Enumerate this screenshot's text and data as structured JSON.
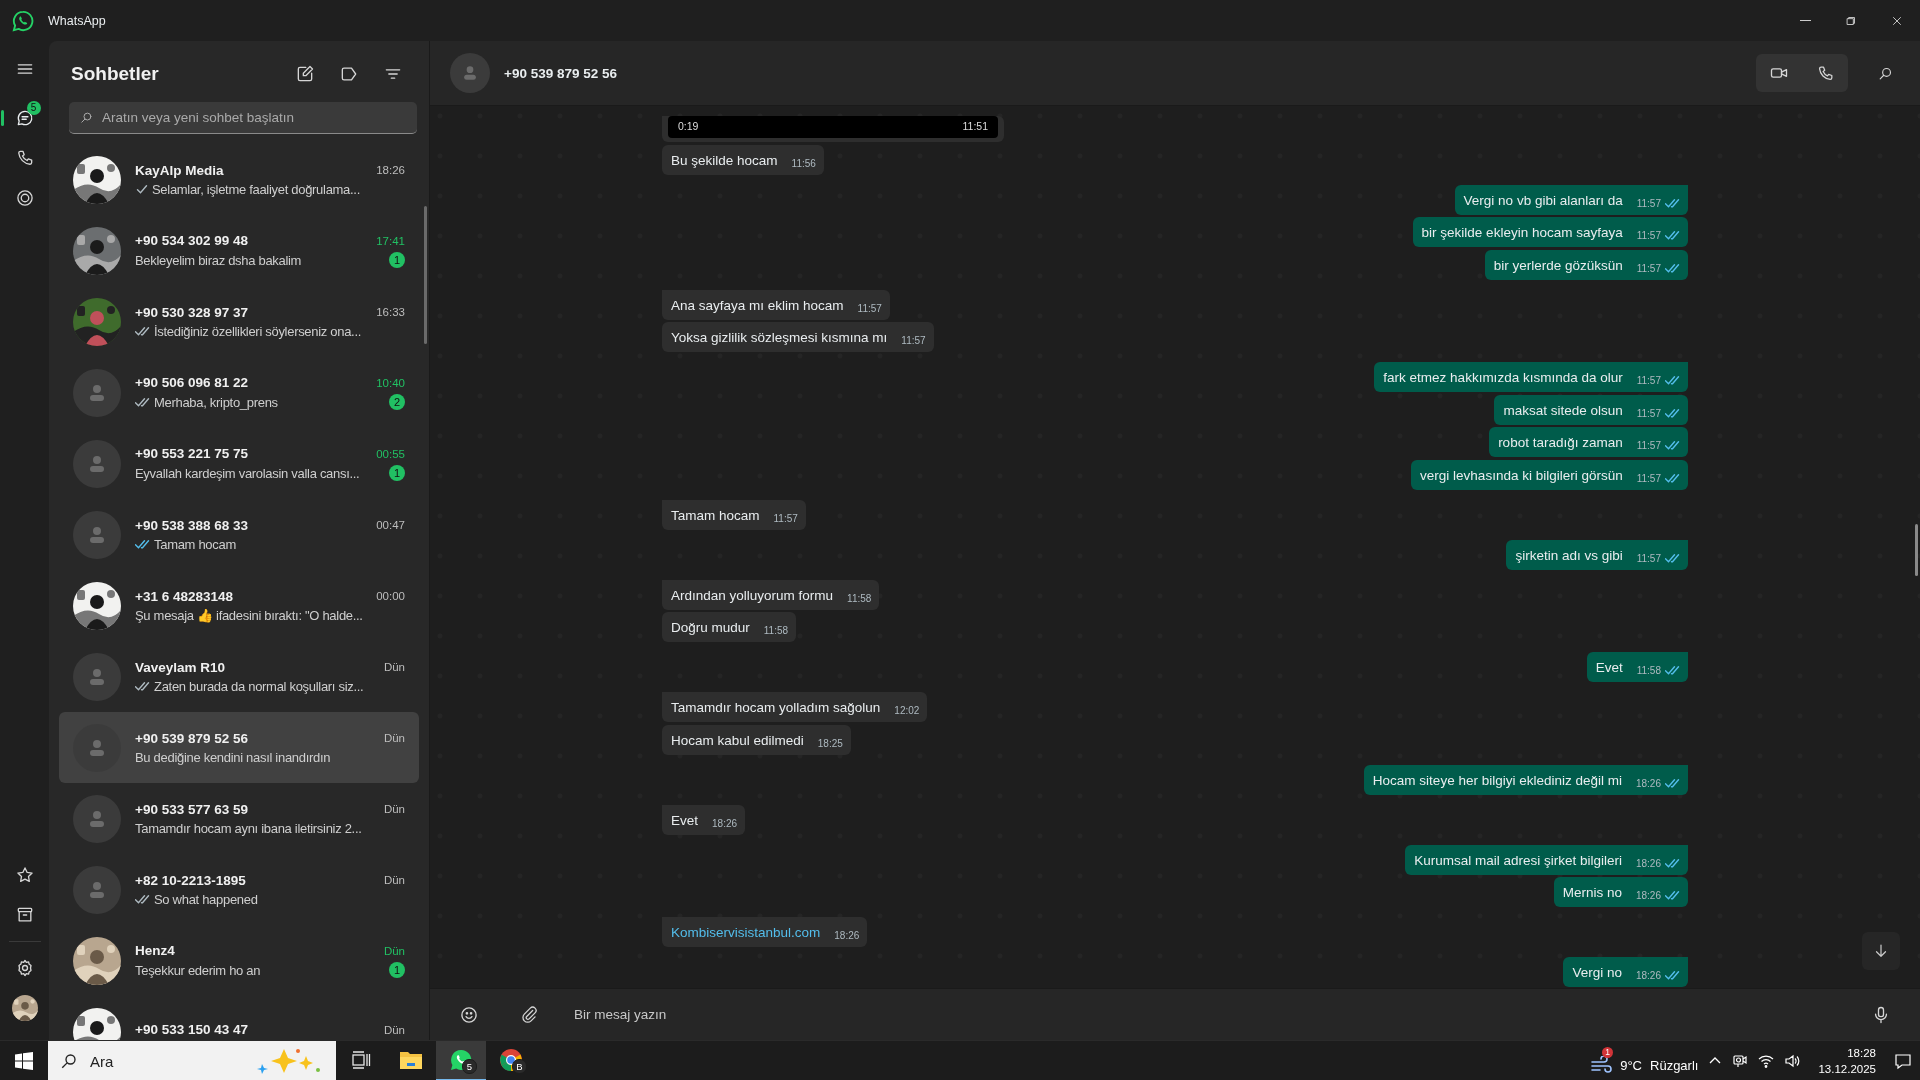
{
  "window": {
    "title": "WhatsApp"
  },
  "rail": {
    "chats_badge": "5",
    "items": [
      {
        "kind": "menu",
        "selected": false
      },
      {
        "kind": "chats",
        "selected": true
      },
      {
        "kind": "calls",
        "selected": false
      },
      {
        "kind": "status",
        "selected": false
      }
    ],
    "bottom": [
      {
        "kind": "starred"
      },
      {
        "kind": "archive"
      },
      {
        "kind": "settings"
      },
      {
        "kind": "profile"
      }
    ]
  },
  "chat_list": {
    "title": "Sohbetler",
    "search": {
      "placeholder": "Aratın veya yeni sohbet başlatın"
    },
    "chats": [
      {
        "kind": "picture",
        "name": "KayAlp Media",
        "time": "18:26",
        "preview": "Selamlar, işletme faaliyet doğrulama...",
        "delivered": false,
        "read": false,
        "selected": false
      },
      {
        "kind": "picture",
        "name": "+90 534 302 99 48",
        "time": "17:41",
        "preview": "Bekleyelim biraz dsha bakalim",
        "unread": "1",
        "selected": false
      },
      {
        "kind": "picture",
        "name": "+90 530 328 97 37",
        "time": "16:33",
        "preview": "İstediğiniz özellikleri söylerseniz ona...",
        "delivered": true,
        "read": false,
        "selected": false
      },
      {
        "kind": "default",
        "name": "+90 506 096 81 22",
        "time": "10:40",
        "preview": "Merhaba, kripto_prens",
        "delivered": true,
        "read": false,
        "unread": "2",
        "selected": false
      },
      {
        "kind": "default",
        "name": "+90 553 221 75 75",
        "time": "00:55",
        "preview": "Eyvallah kardeşim varolasin valla cansı...",
        "unread": "1",
        "selected": false
      },
      {
        "kind": "default",
        "name": "+90 538 388 68 33",
        "time": "00:47",
        "preview": "Tamam hocam",
        "delivered": true,
        "read": true,
        "selected": false
      },
      {
        "kind": "picture",
        "name": "+31 6 48283148",
        "time": "00:00",
        "preview": "Şu mesaja 👍 ifadesini bıraktı: \"O halde...",
        "selected": false
      },
      {
        "kind": "default",
        "name": "Vaveylam R10",
        "time": "Dün",
        "preview": "Zaten burada da normal koşulları siz...",
        "delivered": true,
        "read": false,
        "selected": false
      },
      {
        "kind": "default",
        "name": "+90 539 879 52 56",
        "time": "Dün",
        "preview": "Bu dediğine kendini nasıl inandırdın",
        "selected": true
      },
      {
        "kind": "default",
        "name": "+90 533 577 63 59",
        "time": "Dün",
        "preview": "Tamamdır hocam aynı ibana iletirsiniz 2...",
        "selected": false
      },
      {
        "kind": "default",
        "name": "+82 10-2213-1895",
        "time": "Dün",
        "preview": "So what happened",
        "delivered": true,
        "read": false,
        "selected": false
      },
      {
        "kind": "picture",
        "name": "Henz4",
        "time": "Dün",
        "preview": "Teşekkur ederim ho an",
        "unread": "1",
        "selected": false
      },
      {
        "kind": "picture",
        "name": "+90 533 150 43 47",
        "time": "Dün",
        "selected": false
      }
    ]
  },
  "conversation": {
    "contact": "+90 539 879 52 56",
    "messages": [
      {
        "kind": "video",
        "outgoing": false,
        "duration": "0:19",
        "time": "11:51"
      },
      {
        "kind": "text",
        "outgoing": false,
        "text": "Bu şekilde hocam",
        "time": "11:56"
      },
      {
        "kind": "text",
        "outgoing": true,
        "text": "Vergi no vb gibi alanları da",
        "time": "11:57",
        "read": true
      },
      {
        "kind": "text",
        "outgoing": true,
        "text": "bir şekilde ekleyin hocam sayfaya",
        "time": "11:57",
        "read": true
      },
      {
        "kind": "text",
        "outgoing": true,
        "text": "bir yerlerde gözüksün",
        "time": "11:57",
        "read": true
      },
      {
        "kind": "text",
        "outgoing": false,
        "text": "Ana sayfaya mı eklim hocam",
        "time": "11:57"
      },
      {
        "kind": "text",
        "outgoing": false,
        "text": "Yoksa gizlilik sözleşmesi kısmına mı",
        "time": "11:57"
      },
      {
        "kind": "text",
        "outgoing": true,
        "text": "fark etmez hakkımızda kısmında da olur",
        "time": "11:57",
        "read": true
      },
      {
        "kind": "text",
        "outgoing": true,
        "text": "maksat sitede olsun",
        "time": "11:57",
        "read": true
      },
      {
        "kind": "text",
        "outgoing": true,
        "text": "robot taradığı zaman",
        "time": "11:57",
        "read": true
      },
      {
        "kind": "text",
        "outgoing": true,
        "text": "vergi levhasında ki bilgileri görsün",
        "time": "11:57",
        "read": true
      },
      {
        "kind": "text",
        "outgoing": false,
        "text": "Tamam hocam",
        "time": "11:57"
      },
      {
        "kind": "text",
        "outgoing": true,
        "text": "şirketin adı vs gibi",
        "time": "11:57",
        "read": true
      },
      {
        "kind": "text",
        "outgoing": false,
        "text": "Ardından yolluyorum formu",
        "time": "11:58"
      },
      {
        "kind": "text",
        "outgoing": false,
        "text": "Doğru mudur",
        "time": "11:58"
      },
      {
        "kind": "text",
        "outgoing": true,
        "text": "Evet",
        "time": "11:58",
        "read": true
      },
      {
        "kind": "text",
        "outgoing": false,
        "text": "Tamamdır hocam yolladım sağolun",
        "time": "12:02"
      },
      {
        "kind": "text",
        "outgoing": false,
        "text": "Hocam kabul edilmedi",
        "time": "18:25"
      },
      {
        "kind": "text",
        "outgoing": true,
        "text": "Hocam siteye her bilgiyi eklediniz değil mi",
        "time": "18:26",
        "read": true
      },
      {
        "kind": "text",
        "outgoing": false,
        "text": "Evet",
        "time": "18:26"
      },
      {
        "kind": "text",
        "outgoing": true,
        "text": "Kurumsal mail adresi şirket bilgileri",
        "time": "18:26",
        "read": true
      },
      {
        "kind": "text",
        "outgoing": true,
        "text": "Mernis no",
        "time": "18:26",
        "read": true
      },
      {
        "kind": "link",
        "outgoing": false,
        "text": "Kombiservisistanbul.com",
        "time": "18:26"
      },
      {
        "kind": "text",
        "outgoing": true,
        "text": "Vergi no",
        "time": "18:26",
        "read": true
      }
    ],
    "composer": {
      "placeholder": "Bir mesaj yazın"
    }
  },
  "taskbar": {
    "search": {
      "placeholder": "Ara"
    },
    "apps": [
      {
        "kind": "taskview",
        "selected": false
      },
      {
        "kind": "explorer",
        "selected": false
      },
      {
        "kind": "whatsapp",
        "badge": "5",
        "selected": true
      },
      {
        "kind": "chrome",
        "badge": "B",
        "selected": false
      }
    ],
    "weather": {
      "alert": "1",
      "temperature": "9°C",
      "condition": "Rüzgarlı"
    },
    "clock": {
      "time": "18:28",
      "date": "13.12.2025"
    }
  }
}
